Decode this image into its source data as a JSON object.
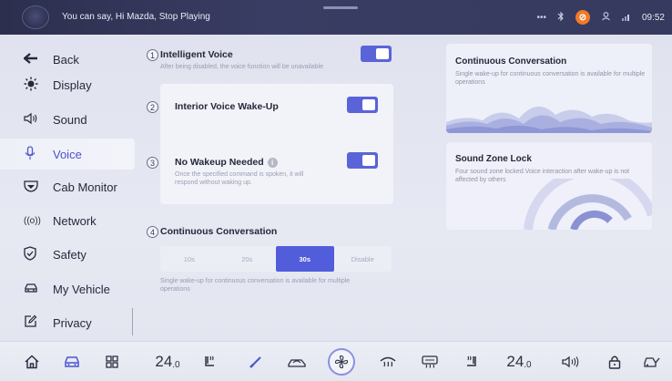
{
  "status_bar": {
    "voice_hint": "You can say, Hi Mazda, Stop Playing",
    "time": "09:52",
    "icons": [
      "more-icon",
      "bluetooth-icon",
      "do-not-disturb-icon",
      "user-icon",
      "signal-icon"
    ]
  },
  "sidebar": {
    "items": [
      {
        "label": "Back",
        "icon": "back-arrow-icon"
      },
      {
        "label": "Display",
        "icon": "brightness-icon"
      },
      {
        "label": "Sound",
        "icon": "speaker-icon"
      },
      {
        "label": "Voice",
        "icon": "microphone-icon",
        "active": true
      },
      {
        "label": "Cab Monitor",
        "icon": "cab-monitor-icon"
      },
      {
        "label": "Network",
        "icon": "network-icon"
      },
      {
        "label": "Safety",
        "icon": "shield-icon"
      },
      {
        "label": "My Vehicle",
        "icon": "car-icon"
      },
      {
        "label": "Privacy",
        "icon": "edit-icon"
      }
    ]
  },
  "main": {
    "intelligent_voice": {
      "number": "1",
      "title": "Intelligent Voice",
      "description": "After being disabled, the voice function will be unavailable",
      "enabled": true
    },
    "interior_wakeup": {
      "number": "2",
      "title": "Interior Voice Wake-Up",
      "enabled": true
    },
    "no_wakeup": {
      "number": "3",
      "title": "No Wakeup Needed",
      "description_line1": "Once the specified command is spoken, it will",
      "description_line2": "respond without waking up.",
      "enabled": true
    },
    "continuous": {
      "number": "4",
      "title": "Continuous Conversation",
      "options": [
        "10s",
        "20s",
        "30s",
        "Disable"
      ],
      "selected": "30s",
      "description_line1": "Single wake-up for continuous conversation is available for multiple",
      "description_line2": "operations"
    }
  },
  "info_cards": {
    "continuous": {
      "title": "Continuous Conversation",
      "description": "Single wake-up for continuous conversation is available for multiple operations"
    },
    "sound_zone": {
      "title": "Sound Zone Lock",
      "description": "Four sound zone locked.Voice interaction after wake-up is not affected by others"
    }
  },
  "bottom_bar": {
    "left_temp": "24",
    "left_temp_decimal": ".0",
    "right_temp": "24",
    "right_temp_decimal": ".0"
  },
  "colors": {
    "accent": "#525ddb",
    "status_bar": "#2c2f4e",
    "dnd": "#f07a2a"
  }
}
